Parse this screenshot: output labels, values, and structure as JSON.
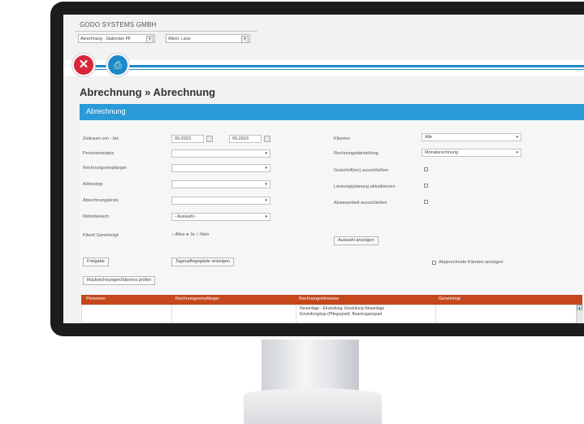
{
  "header": {
    "company": "GODO SYSTEMS GMBH",
    "module_select": "Abrechnung - Stationäre Pfl",
    "user_select": "Albert, Luise"
  },
  "page_title": "Abrechnung » Abrechnung",
  "panel_title": "Abrechnung",
  "left_fields": {
    "zeitraum_label": "Zeitraum von - bis",
    "date_from": "09.2023",
    "date_to": "09.2023",
    "personenstatus_label": "Personenstatus",
    "rechnungsempfaenger_label": "Rechnungsempfänger",
    "adresstyp_label": "Adresstyp",
    "abrechnungskreis_label": "Abrechnungskreis",
    "wohnbereich_label": "Wohnbereich",
    "wohnbereich_value": "- Auswahl -",
    "klient_label": "Klient/ Genehmigt",
    "radio_alle": "Alles",
    "radio_ja": "Ja",
    "radio_nein": "Nein"
  },
  "right_fields": {
    "klienten_label": "Klienten",
    "klienten_value": "Alle",
    "rechnungsdarstellung_label": "Rechnungsdarstellung",
    "rechnungsdarstellung_value": "Monatsrechnung",
    "gutschriften_label": "Gutschrift(en) ausschließen",
    "leistungsplanung_label": "Leistungsplanung aktualisieren",
    "abwesenheit_label": "Abwesenheit ausschließen",
    "auswahl_button": "Auswahl anzeigen",
    "abgerechnete_label": "Abgerechnete Klienten anzeigen"
  },
  "buttons": {
    "freigabe": "Freigabe",
    "tagespflege": "Tagespflegegäste anzeigen",
    "rueckrechnungen": "Rückrechnungen/Stornos prüfen"
  },
  "table": {
    "headers": [
      "Personen",
      "Rechnungsempfänger",
      "Rechnungshinweise",
      "Genehmigt"
    ],
    "row_hint_line1": "Neuanlage - Einstufung: Einstufung Neuanlage",
    "row_hint_line2": "Einstufungstyp (Pflegegrad): Beantragungsart"
  },
  "colors": {
    "accent_blue": "#2b9ad8",
    "table_header": "#c5481c",
    "close_red": "#d9263a"
  },
  "icons": [
    "close-icon",
    "print-icon",
    "calendar-icon",
    "dropdown-caret-icon"
  ]
}
